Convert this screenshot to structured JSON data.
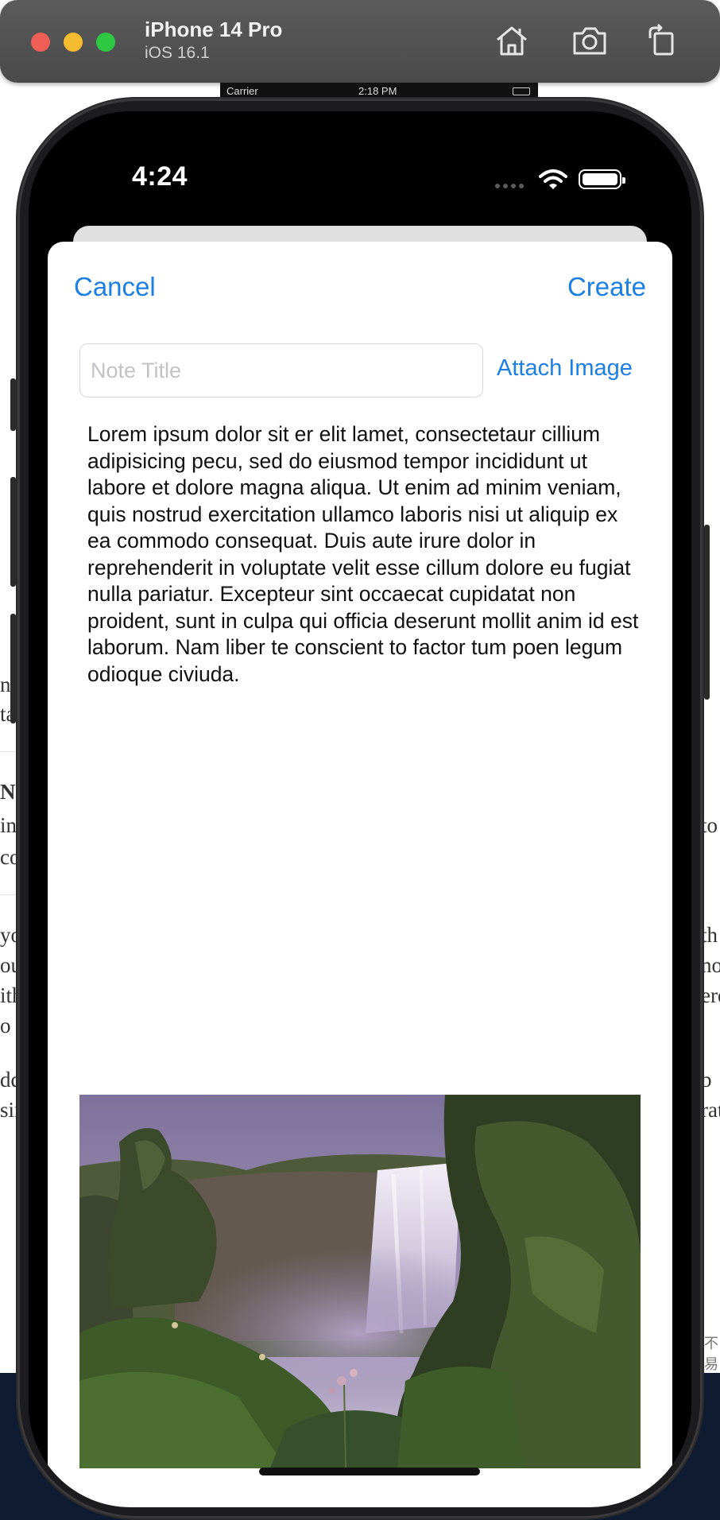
{
  "simulator": {
    "device_name": "iPhone 14 Pro",
    "os_version": "iOS 16.1",
    "toolbar_icons": [
      "home-icon",
      "screenshot-camera-icon",
      "rotate-icon"
    ]
  },
  "inner_status": {
    "carrier": "Carrier",
    "time": "2:18 PM"
  },
  "status_bar": {
    "time": "4:24",
    "icons": [
      "signal-dots-icon",
      "wifi-icon",
      "battery-icon"
    ]
  },
  "sheet": {
    "cancel_label": "Cancel",
    "create_label": "Create",
    "title_placeholder": "Note Title",
    "title_value": "",
    "attach_image_label": "Attach Image",
    "body_text": "Lorem ipsum dolor sit er elit lamet, consectetaur cillium adipisicing pecu, sed do eiusmod tempor incididunt ut labore et dolore magna aliqua. Ut enim ad minim veniam, quis nostrud exercitation ullamco laboris nisi ut aliquip ex ea commodo consequat. Duis aute irure dolor in reprehenderit in voluptate velit esse cillum dolore eu fugiat nulla pariatur. Excepteur sint occaecat cupidatat non proident, sunt in culpa qui officia deserunt mollit anim id est laborum. Nam liber te conscient to factor tum poen legum odioque civiuda."
  },
  "background_fragments": {
    "left": [
      "nc",
      "ta",
      "N",
      "in",
      "co",
      "yo",
      "ou",
      "ith",
      "o c",
      "dd",
      "sin"
    ],
    "right": [
      "to",
      "th",
      "no",
      "ere",
      "b",
      "rat"
    ],
    "cjk": "不易"
  },
  "colors": {
    "accent": "#1b7fe3",
    "toolbar": "#4f4f4f",
    "phone_bezel": "#1c1c1e"
  }
}
